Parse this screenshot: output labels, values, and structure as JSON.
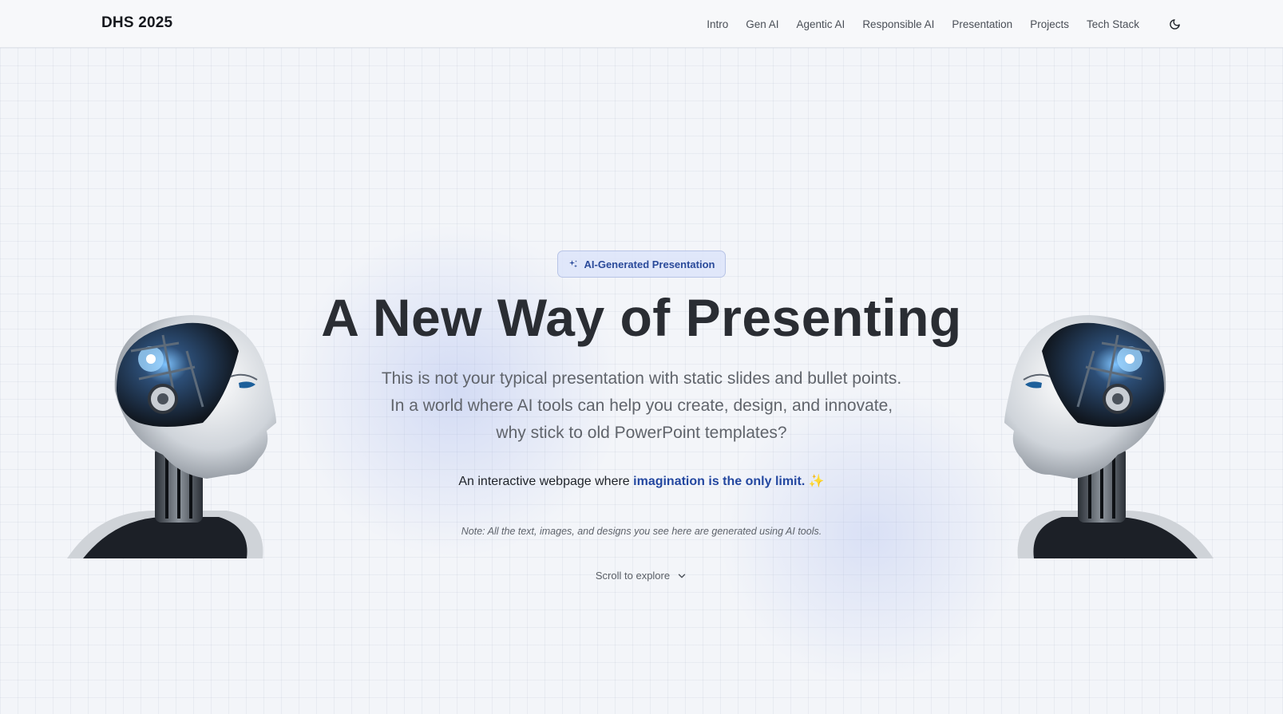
{
  "nav": {
    "brand": "DHS 2025",
    "links": [
      "Intro",
      "Gen AI",
      "Agentic AI",
      "Responsible AI",
      "Presentation",
      "Projects",
      "Tech Stack"
    ],
    "theme_icon": "moon-icon"
  },
  "hero": {
    "badge": "AI-Generated Presentation",
    "badge_icon": "sparkles-icon",
    "title": "A New Way of Presenting",
    "description": "This is not your typical presentation with static slides and bullet points. In a world where AI tools can help you create, design, and innovate, why stick to old PowerPoint templates?",
    "tagline_prefix": "An interactive webpage where ",
    "tagline_highlight": "imagination is the only limit.",
    "tagline_emoji": "✨",
    "note": "Note: All the text, images, and designs you see here are generated using AI tools.",
    "scroll_label": "Scroll to explore",
    "scroll_icon": "chevron-down-icon"
  },
  "colors": {
    "accent": "#2448a0",
    "badge_bg": "#dce4fa",
    "badge_border": "#b8c4e6",
    "background": "#f3f5f9"
  }
}
